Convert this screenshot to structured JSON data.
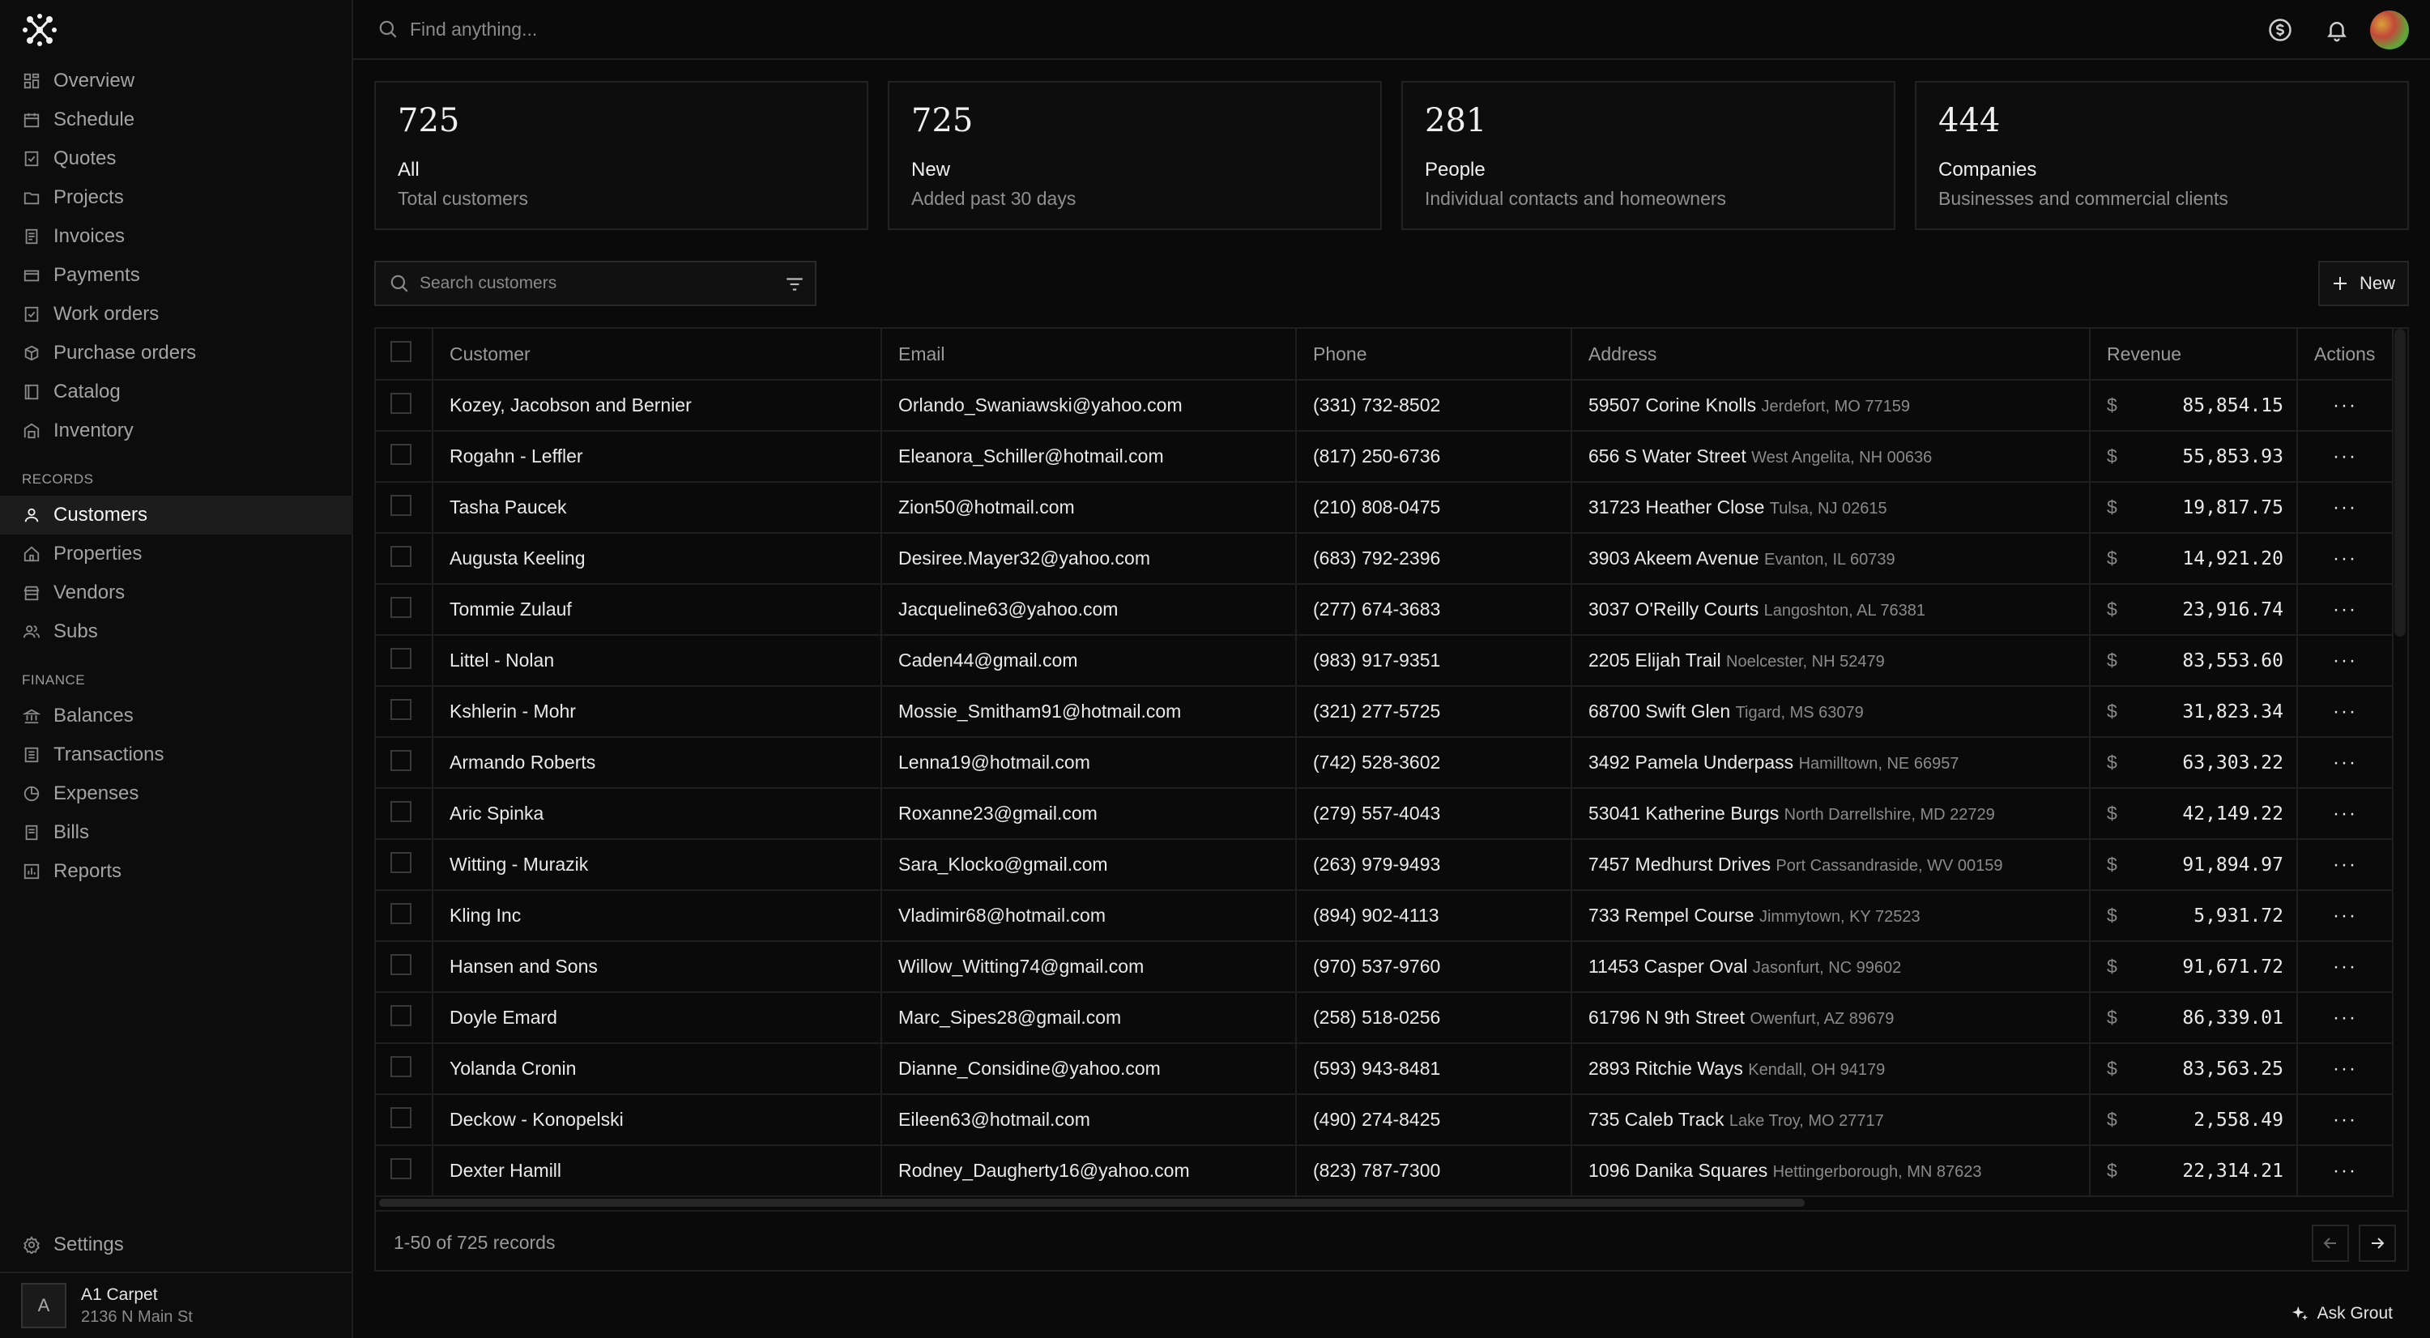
{
  "sidebar": {
    "nav": [
      {
        "label": "Overview",
        "icon": "overview-icon"
      },
      {
        "label": "Schedule",
        "icon": "calendar-icon"
      },
      {
        "label": "Quotes",
        "icon": "quote-icon"
      },
      {
        "label": "Projects",
        "icon": "folder-icon"
      },
      {
        "label": "Invoices",
        "icon": "invoice-icon"
      },
      {
        "label": "Payments",
        "icon": "payment-icon"
      },
      {
        "label": "Work orders",
        "icon": "checklist-icon"
      },
      {
        "label": "Purchase orders",
        "icon": "box-icon"
      },
      {
        "label": "Catalog",
        "icon": "catalog-icon"
      },
      {
        "label": "Inventory",
        "icon": "warehouse-icon"
      }
    ],
    "records_title": "RECORDS",
    "records": [
      {
        "label": "Customers",
        "icon": "person-icon",
        "active": true
      },
      {
        "label": "Properties",
        "icon": "home-icon"
      },
      {
        "label": "Vendors",
        "icon": "store-icon"
      },
      {
        "label": "Subs",
        "icon": "users-icon"
      }
    ],
    "finance_title": "FINANCE",
    "finance": [
      {
        "label": "Balances",
        "icon": "bank-icon"
      },
      {
        "label": "Transactions",
        "icon": "ledger-icon"
      },
      {
        "label": "Expenses",
        "icon": "pie-icon"
      },
      {
        "label": "Bills",
        "icon": "bill-icon"
      },
      {
        "label": "Reports",
        "icon": "report-icon"
      }
    ],
    "settings": "Settings",
    "account": {
      "initial": "A",
      "name": "A1 Carpet",
      "address": "2136 N Main St"
    }
  },
  "topbar": {
    "search_placeholder": "Find anything..."
  },
  "stats": [
    {
      "value": "725",
      "title": "All",
      "subtitle": "Total customers"
    },
    {
      "value": "725",
      "title": "New",
      "subtitle": "Added past 30 days"
    },
    {
      "value": "281",
      "title": "People",
      "subtitle": "Individual contacts and homeowners"
    },
    {
      "value": "444",
      "title": "Companies",
      "subtitle": "Businesses and commercial clients"
    }
  ],
  "toolbar": {
    "search_placeholder": "Search customers",
    "new_label": "New"
  },
  "table": {
    "columns": [
      "Customer",
      "Email",
      "Phone",
      "Address",
      "Revenue",
      "Actions"
    ],
    "currency": "$",
    "rows": [
      {
        "customer": "Kozey, Jacobson and Bernier",
        "email": "Orlando_Swaniawski@yahoo.com",
        "phone": "(331) 732-8502",
        "street": "59507 Corine Knolls",
        "city": "Jerdefort, MO 77159",
        "revenue": "85,854.15"
      },
      {
        "customer": "Rogahn - Leffler",
        "email": "Eleanora_Schiller@hotmail.com",
        "phone": "(817) 250-6736",
        "street": "656 S Water Street",
        "city": "West Angelita, NH 00636",
        "revenue": "55,853.93"
      },
      {
        "customer": "Tasha Paucek",
        "email": "Zion50@hotmail.com",
        "phone": "(210) 808-0475",
        "street": "31723 Heather Close",
        "city": "Tulsa, NJ 02615",
        "revenue": "19,817.75"
      },
      {
        "customer": "Augusta Keeling",
        "email": "Desiree.Mayer32@yahoo.com",
        "phone": "(683) 792-2396",
        "street": "3903 Akeem Avenue",
        "city": "Evanton, IL 60739",
        "revenue": "14,921.20"
      },
      {
        "customer": "Tommie Zulauf",
        "email": "Jacqueline63@yahoo.com",
        "phone": "(277) 674-3683",
        "street": "3037 O'Reilly Courts",
        "city": "Langoshton, AL 76381",
        "revenue": "23,916.74"
      },
      {
        "customer": "Littel - Nolan",
        "email": "Caden44@gmail.com",
        "phone": "(983) 917-9351",
        "street": "2205 Elijah Trail",
        "city": "Noelcester, NH 52479",
        "revenue": "83,553.60"
      },
      {
        "customer": "Kshlerin - Mohr",
        "email": "Mossie_Smitham91@hotmail.com",
        "phone": "(321) 277-5725",
        "street": "68700 Swift Glen",
        "city": "Tigard, MS 63079",
        "revenue": "31,823.34"
      },
      {
        "customer": "Armando Roberts",
        "email": "Lenna19@hotmail.com",
        "phone": "(742) 528-3602",
        "street": "3492 Pamela Underpass",
        "city": "Hamilltown, NE 66957",
        "revenue": "63,303.22"
      },
      {
        "customer": "Aric Spinka",
        "email": "Roxanne23@gmail.com",
        "phone": "(279) 557-4043",
        "street": "53041 Katherine Burgs",
        "city": "North Darrellshire, MD 22729",
        "revenue": "42,149.22"
      },
      {
        "customer": "Witting - Murazik",
        "email": "Sara_Klocko@gmail.com",
        "phone": "(263) 979-9493",
        "street": "7457 Medhurst Drives",
        "city": "Port Cassandraside, WV 00159",
        "revenue": "91,894.97"
      },
      {
        "customer": "Kling Inc",
        "email": "Vladimir68@hotmail.com",
        "phone": "(894) 902-4113",
        "street": "733 Rempel Course",
        "city": "Jimmytown, KY 72523",
        "revenue": "5,931.72"
      },
      {
        "customer": "Hansen and Sons",
        "email": "Willow_Witting74@gmail.com",
        "phone": "(970) 537-9760",
        "street": "11453 Casper Oval",
        "city": "Jasonfurt, NC 99602",
        "revenue": "91,671.72"
      },
      {
        "customer": "Doyle Emard",
        "email": "Marc_Sipes28@gmail.com",
        "phone": "(258) 518-0256",
        "street": "61796 N 9th Street",
        "city": "Owenfurt, AZ 89679",
        "revenue": "86,339.01"
      },
      {
        "customer": "Yolanda Cronin",
        "email": "Dianne_Considine@yahoo.com",
        "phone": "(593) 943-8481",
        "street": "2893 Ritchie Ways",
        "city": "Kendall, OH 94179",
        "revenue": "83,563.25"
      },
      {
        "customer": "Deckow - Konopelski",
        "email": "Eileen63@hotmail.com",
        "phone": "(490) 274-8425",
        "street": "735 Caleb Track",
        "city": "Lake Troy, MO 27717",
        "revenue": "2,558.49"
      },
      {
        "customer": "Dexter Hamill",
        "email": "Rodney_Daugherty16@yahoo.com",
        "phone": "(823) 787-7300",
        "street": "1096 Danika Squares",
        "city": "Hettingerborough, MN 87623",
        "revenue": "22,314.21"
      }
    ],
    "footer": "1-50 of 725 records"
  },
  "ask_label": "Ask Grout",
  "colors": {
    "background": "#0a0a0a",
    "border": "#1f1f1f",
    "muted": "#8a8a8a",
    "active_nav": "#1c1c1c"
  }
}
